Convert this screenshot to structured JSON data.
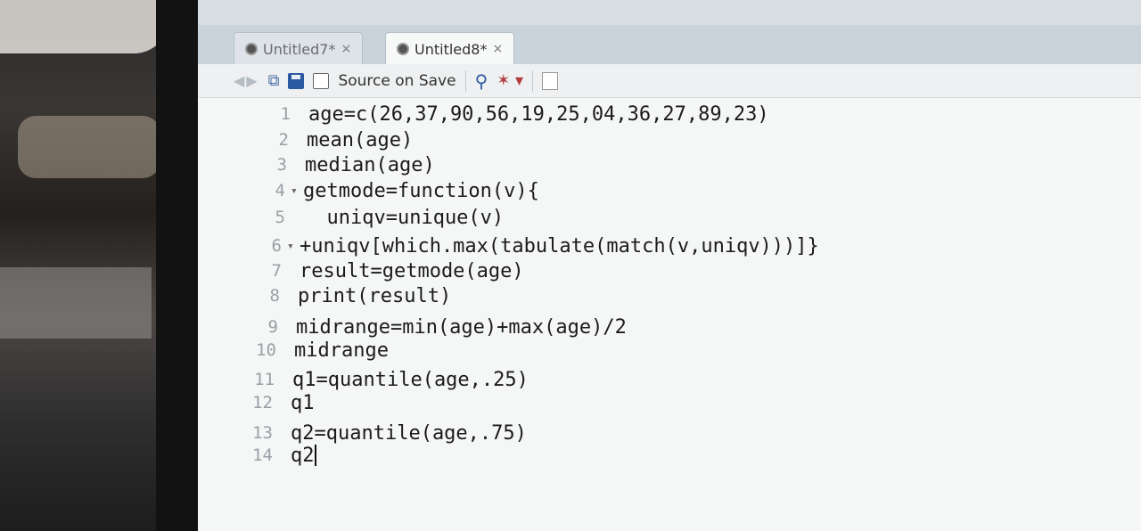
{
  "tabs": [
    {
      "label": "Untitled7*",
      "close": "×",
      "active": false
    },
    {
      "label": "Untitled8*",
      "close": "×",
      "active": true
    }
  ],
  "toolbar": {
    "source_on_save_label": "Source on Save",
    "source_on_save_checked": false,
    "icons": [
      "back-arrow-icon",
      "forward-arrow-icon",
      "show-in-window-icon",
      "save-icon",
      "search-icon",
      "code-tools-wand-icon",
      "compile-report-icon"
    ]
  },
  "editor": {
    "lines": [
      {
        "num": "1",
        "fold": "",
        "text": "age=c(26,37,90,56,19,25,04,36,27,89,23)"
      },
      {
        "num": "2",
        "fold": "",
        "text": "mean(age)"
      },
      {
        "num": "3",
        "fold": "",
        "text": "median(age)"
      },
      {
        "num": "4",
        "fold": "▾",
        "text": "getmode=function(v){"
      },
      {
        "num": "5",
        "fold": "",
        "text": "  uniqv=unique(v)"
      },
      {
        "num": "6",
        "fold": "▾",
        "text": "+uniqv[which.max(tabulate(match(v,uniqv)))]}"
      },
      {
        "num": "7",
        "fold": "",
        "text": "result=getmode(age)"
      },
      {
        "num": "8",
        "fold": "",
        "text": "print(result)"
      },
      {
        "num": "9",
        "fold": "",
        "text": "midrange=min(age)+max(age)/2"
      },
      {
        "num": "10",
        "fold": "",
        "text": "midrange"
      },
      {
        "num": "11",
        "fold": "",
        "text": "q1=quantile(age,.25)"
      },
      {
        "num": "12",
        "fold": "",
        "text": "q1"
      },
      {
        "num": "13",
        "fold": "",
        "text": "q2=quantile(age,.75)"
      },
      {
        "num": "14",
        "fold": "",
        "text": "q2"
      }
    ]
  },
  "colors": {
    "keyword": "#1f3fb0",
    "text": "#1b1b1b",
    "line_number": "#9aa0a5"
  }
}
